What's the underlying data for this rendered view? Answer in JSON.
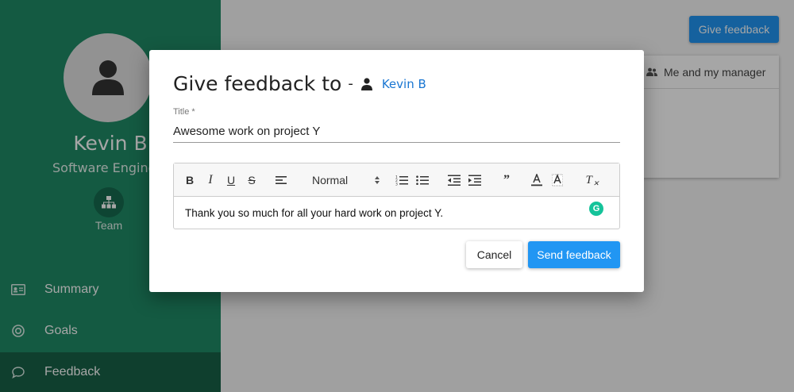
{
  "profile": {
    "name": "Kevin B",
    "role": "Software Engineer",
    "team_label": "Team"
  },
  "nav": {
    "items": [
      {
        "label": "Summary",
        "icon": "id-card-icon"
      },
      {
        "label": "Goals",
        "icon": "target-icon"
      },
      {
        "label": "Feedback",
        "icon": "chat-bubble-icon",
        "active": true
      }
    ]
  },
  "header": {
    "give_feedback_label": "Give feedback"
  },
  "tabs": {
    "me_and_manager_label": "Me and my manager"
  },
  "modal": {
    "title": "Give feedback to",
    "dash": "-",
    "recipient": "Kevin B",
    "title_field_label": "Title *",
    "title_value": "Awesome work on project Y",
    "toolbar": {
      "bold": "B",
      "italic": "I",
      "underline": "U",
      "strike": "S",
      "header_value": "Normal",
      "blockquote": "”",
      "clean": "T"
    },
    "body_text": "Thank you so much for all your hard work on project Y.",
    "grammarly_glyph": "G",
    "cancel_label": "Cancel",
    "send_label": "Send feedback"
  },
  "colors": {
    "sidebar": "#1f8a66",
    "accent": "#2196f3",
    "link": "#1976d2"
  }
}
